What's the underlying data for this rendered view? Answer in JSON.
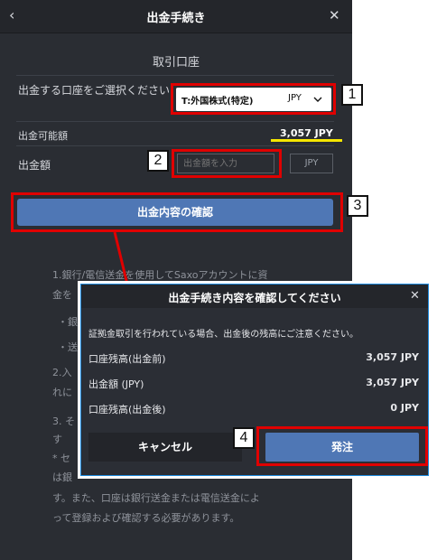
{
  "panel": {
    "header": {
      "back_icon": "chevron-left",
      "title": "出金手続き",
      "close_icon": "close"
    },
    "section_title": "取引口座",
    "account_label": "出金する口座をご選択ください",
    "account_select": {
      "value": "T:外国株式(特定)",
      "currency": "JPY"
    },
    "available_label": "出金可能額",
    "available_value": "3,057 JPY",
    "amount_label": "出金額",
    "amount_input": {
      "placeholder": "出金額を入力",
      "currency": "JPY"
    },
    "confirm_button": "出金内容の確認",
    "notes": [
      "1.銀行/電信送金を使用してSaxoアカウントに資",
      "金を",
      "・銀",
      "・送",
      "2.入",
      "れに",
      "3. そ",
      "す",
      "* セ",
      "は銀",
      "す。また、口座は銀行送金または電信送金によ",
      "って登録および確認する必要があります。"
    ]
  },
  "dialog": {
    "title": "出金手続き内容を確認してください",
    "warning": "証拠金取引を行われている場合、出金後の残高にご注意ください。",
    "rows": [
      {
        "label": "口座残高(出金前)",
        "value": "3,057 JPY"
      },
      {
        "label": "出金額 (JPY)",
        "value": "3,057 JPY"
      },
      {
        "label": "口座残高(出金後)",
        "value": "0 JPY"
      }
    ],
    "cancel_button": "キャンセル",
    "submit_button": "発注"
  },
  "annotations": {
    "markers": [
      "1",
      "2",
      "3",
      "4"
    ],
    "highlight_color": "#e00000",
    "underline_color": "#f5e600"
  }
}
